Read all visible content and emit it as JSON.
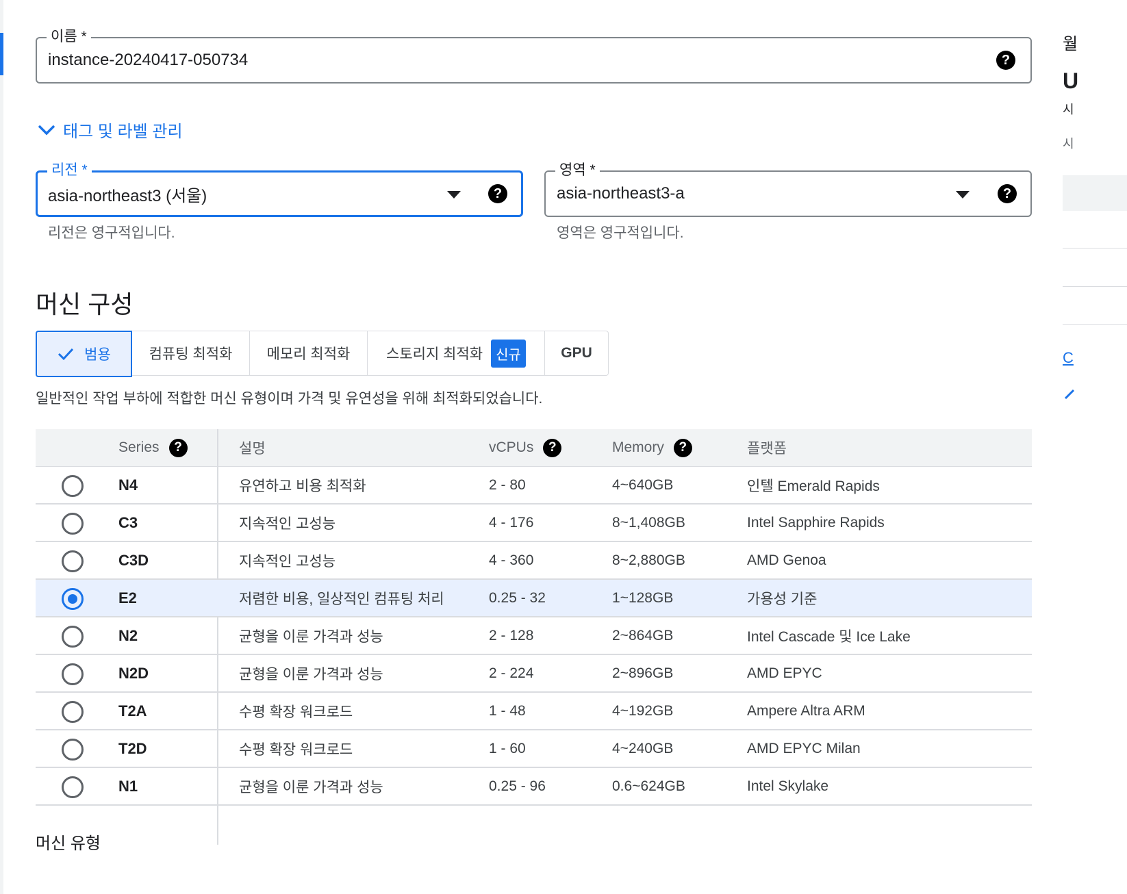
{
  "name_field": {
    "label": "이름 *",
    "value": "instance-20240417-050734",
    "help": "?"
  },
  "manage_tags": {
    "label": "태그 및 라벨 관리"
  },
  "region_field": {
    "label": "리전 *",
    "value": "asia-northeast3 (서울)",
    "hint": "리전은 영구적입니다.",
    "help": "?"
  },
  "zone_field": {
    "label": "영역 *",
    "value": "asia-northeast3-a",
    "hint": "영역은 영구적입니다.",
    "help": "?"
  },
  "machine_config": {
    "title": "머신 구성",
    "tabs": [
      {
        "label": "범용",
        "active": true
      },
      {
        "label": "컴퓨팅 최적화"
      },
      {
        "label": "메모리 최적화"
      },
      {
        "label": "스토리지 최적화",
        "badge": "신규"
      },
      {
        "label": "GPU"
      }
    ],
    "description": "일반적인 작업 부하에 적합한 머신 유형이며 가격 및 유연성을 위해 최적화되었습니다.",
    "columns": {
      "series": "Series",
      "desc": "설명",
      "vcpus": "vCPUs",
      "memory": "Memory",
      "platform": "플랫폼"
    },
    "rows": [
      {
        "series": "N4",
        "desc": "유연하고 비용 최적화",
        "vcpus": "2 - 80",
        "memory": "4~640GB",
        "platform": "인텔 Emerald Rapids",
        "selected": false
      },
      {
        "series": "C3",
        "desc": "지속적인 고성능",
        "vcpus": "4 - 176",
        "memory": "8~1,408GB",
        "platform": "Intel Sapphire Rapids",
        "selected": false
      },
      {
        "series": "C3D",
        "desc": "지속적인 고성능",
        "vcpus": "4 - 360",
        "memory": "8~2,880GB",
        "platform": "AMD Genoa",
        "selected": false
      },
      {
        "series": "E2",
        "desc": "저렴한 비용, 일상적인 컴퓨팅 처리",
        "vcpus": "0.25 - 32",
        "memory": "1~128GB",
        "platform": "가용성 기준",
        "selected": true
      },
      {
        "series": "N2",
        "desc": "균형을 이룬 가격과 성능",
        "vcpus": "2 - 128",
        "memory": "2~864GB",
        "platform": "Intel Cascade 및 Ice Lake",
        "selected": false
      },
      {
        "series": "N2D",
        "desc": "균형을 이룬 가격과 성능",
        "vcpus": "2 - 224",
        "memory": "2~896GB",
        "platform": "AMD EPYC",
        "selected": false
      },
      {
        "series": "T2A",
        "desc": "수평 확장 워크로드",
        "vcpus": "1 - 48",
        "memory": "4~192GB",
        "platform": "Ampere Altra ARM",
        "selected": false
      },
      {
        "series": "T2D",
        "desc": "수평 확장 워크로드",
        "vcpus": "1 - 60",
        "memory": "4~240GB",
        "platform": "AMD EPYC Milan",
        "selected": false
      },
      {
        "series": "N1",
        "desc": "균형을 이룬 가격과 성능",
        "vcpus": "0.25 - 96",
        "memory": "0.6~624GB",
        "platform": "Intel Skylake",
        "selected": false
      }
    ],
    "machine_type_title": "머신 유형"
  },
  "right_panel": {
    "t1": "월",
    "t2": "U",
    "t3": "시",
    "t4": "시",
    "link": "C"
  },
  "colors": {
    "accent": "#1a73e8",
    "selected_row": "#e8f0fe",
    "header_bg": "#f1f3f4"
  }
}
